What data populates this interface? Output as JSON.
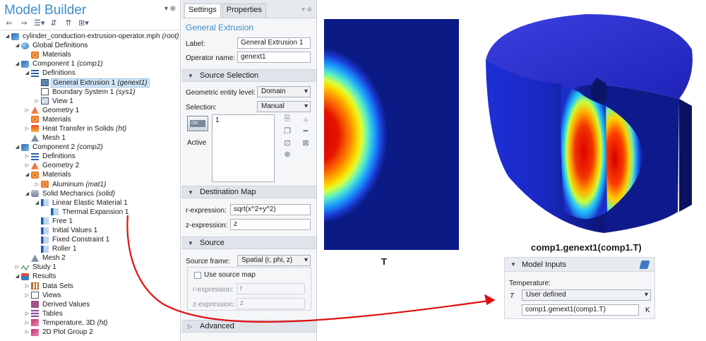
{
  "model_builder": {
    "title": "Model Builder",
    "pin_icons": "▾ ⊕",
    "tree": [
      {
        "depth": 0,
        "tw": "◢",
        "icon": "ic-cube",
        "iconName": "model-root-icon",
        "label": "cylinder_conduction-extrusion-operator.mph",
        "tag": "(root)"
      },
      {
        "depth": 1,
        "tw": "◢",
        "icon": "ic-globe",
        "iconName": "global-definitions-icon",
        "label": "Global Definitions",
        "tag": ""
      },
      {
        "depth": 2,
        "tw": "",
        "icon": "ic-mat",
        "iconName": "materials-icon",
        "label": "Materials",
        "tag": ""
      },
      {
        "depth": 1,
        "tw": "◢",
        "icon": "ic-cube",
        "iconName": "component-icon",
        "label": "Component 1",
        "tag": "(comp1)"
      },
      {
        "depth": 2,
        "tw": "◢",
        "icon": "ic-list",
        "iconName": "definitions-icon",
        "label": "Definitions",
        "tag": ""
      },
      {
        "depth": 3,
        "tw": "",
        "icon": "ic-ext",
        "iconName": "extrusion-icon",
        "label": "General Extrusion 1",
        "tag": "(genext1)",
        "selected": true
      },
      {
        "depth": 3,
        "tw": "",
        "icon": "ic-coord",
        "iconName": "coordinate-system-icon",
        "label": "Boundary System 1",
        "tag": "(sys1)"
      },
      {
        "depth": 3,
        "tw": "▷",
        "icon": "ic-view",
        "iconName": "view-icon",
        "label": "View 1",
        "tag": ""
      },
      {
        "depth": 2,
        "tw": "▷",
        "icon": "ic-geo",
        "iconName": "geometry-icon",
        "label": "Geometry 1",
        "tag": ""
      },
      {
        "depth": 2,
        "tw": "",
        "icon": "ic-mat",
        "iconName": "materials-icon",
        "label": "Materials",
        "tag": ""
      },
      {
        "depth": 2,
        "tw": "▷",
        "icon": "ic-heat",
        "iconName": "heat-transfer-icon",
        "label": "Heat Transfer in Solids",
        "tag": "(ht)"
      },
      {
        "depth": 2,
        "tw": "",
        "icon": "ic-mesh",
        "iconName": "mesh-icon",
        "label": "Mesh 1",
        "tag": ""
      },
      {
        "depth": 1,
        "tw": "◢",
        "icon": "ic-cube",
        "iconName": "component-icon",
        "label": "Component 2",
        "tag": "(comp2)"
      },
      {
        "depth": 2,
        "tw": "▷",
        "icon": "ic-list",
        "iconName": "definitions-icon",
        "label": "Definitions",
        "tag": ""
      },
      {
        "depth": 2,
        "tw": "▷",
        "icon": "ic-geo",
        "iconName": "geometry-icon",
        "label": "Geometry 2",
        "tag": ""
      },
      {
        "depth": 2,
        "tw": "◢",
        "icon": "ic-mat",
        "iconName": "materials-icon",
        "label": "Materials",
        "tag": ""
      },
      {
        "depth": 3,
        "tw": "▷",
        "icon": "ic-mat",
        "iconName": "material-icon",
        "label": "Aluminum",
        "tag": "(mat1)"
      },
      {
        "depth": 2,
        "tw": "◢",
        "icon": "ic-solid",
        "iconName": "solid-mechanics-icon",
        "label": "Solid Mechanics",
        "tag": "(solid)"
      },
      {
        "depth": 3,
        "tw": "◢",
        "icon": "ic-bar",
        "iconName": "linear-elastic-icon",
        "label": "Linear Elastic Material 1",
        "tag": ""
      },
      {
        "depth": 4,
        "tw": "",
        "icon": "ic-bar",
        "iconName": "thermal-expansion-icon",
        "label": "Thermal Expansion 1",
        "tag": ""
      },
      {
        "depth": 3,
        "tw": "",
        "icon": "ic-bar",
        "iconName": "free-icon",
        "label": "Free 1",
        "tag": ""
      },
      {
        "depth": 3,
        "tw": "",
        "icon": "ic-bar",
        "iconName": "initial-values-icon",
        "label": "Initial Values 1",
        "tag": ""
      },
      {
        "depth": 3,
        "tw": "",
        "icon": "ic-bar",
        "iconName": "fixed-constraint-icon",
        "label": "Fixed Constraint 1",
        "tag": ""
      },
      {
        "depth": 3,
        "tw": "",
        "icon": "ic-bar",
        "iconName": "roller-icon",
        "label": "Roller 1",
        "tag": ""
      },
      {
        "depth": 2,
        "tw": "",
        "icon": "ic-mesh",
        "iconName": "mesh-icon",
        "label": "Mesh 2",
        "tag": ""
      },
      {
        "depth": 1,
        "tw": "▷",
        "icon": "ic-study",
        "iconName": "study-icon",
        "label": "Study 1",
        "tag": ""
      },
      {
        "depth": 1,
        "tw": "◢",
        "icon": "ic-res",
        "iconName": "results-icon",
        "label": "Results",
        "tag": ""
      },
      {
        "depth": 2,
        "tw": "▷",
        "icon": "ic-grid",
        "iconName": "data-sets-icon",
        "label": "Data Sets",
        "tag": ""
      },
      {
        "depth": 2,
        "tw": "▷",
        "icon": "ic-coord",
        "iconName": "views-icon",
        "label": "Views",
        "tag": ""
      },
      {
        "depth": 2,
        "tw": "",
        "icon": "ic-val",
        "iconName": "derived-values-icon",
        "label": "Derived Values",
        "tag": ""
      },
      {
        "depth": 2,
        "tw": "▷",
        "icon": "ic-tab",
        "iconName": "tables-icon",
        "label": "Tables",
        "tag": ""
      },
      {
        "depth": 2,
        "tw": "▷",
        "icon": "ic-plot",
        "iconName": "plot-group-icon",
        "label": "Temperature, 3D",
        "tag": "(ht)"
      },
      {
        "depth": 2,
        "tw": "▷",
        "icon": "ic-plot",
        "iconName": "plot-group-icon",
        "label": "2D Plot Group 2",
        "tag": ""
      }
    ]
  },
  "settings": {
    "tabs": [
      "Settings",
      "Properties"
    ],
    "tab_tools": "▾ ⊕",
    "title": "General Extrusion",
    "label_label": "Label:",
    "label_value": "General Extrusion 1",
    "operator_label": "Operator name:",
    "operator_value": "genext1",
    "source_selection_header": "Source Selection",
    "entity_level_label": "Geometric entity level:",
    "entity_level_value": "Domain",
    "selection_label": "Selection:",
    "selection_value": "Manual",
    "selection_item": "1",
    "active_badge": "ON",
    "active_label": "Active",
    "destination_header": "Destination Map",
    "r_label": "r-expression:",
    "r_value": "sqrt(x^2+y^2)",
    "z_label": "z-expression:",
    "z_value": "z",
    "source_header": "Source",
    "frame_label": "Source frame:",
    "frame_value": "Spatial  (r, phi, z)",
    "use_map_label": "Use source map",
    "r2_label": "r-expression:",
    "r2_value": "r",
    "z2_label": "z-expression:",
    "z2_value": "z",
    "advanced_header": "Advanced"
  },
  "plots": {
    "left_caption": "T",
    "right_caption": "comp1.genext1(comp1.T)"
  },
  "model_inputs": {
    "header": "Model Inputs",
    "temperature_label": "Temperature:",
    "symbol": "T",
    "dropdown_value": "User defined",
    "expression_value": "comp1.genext1(comp1.T)",
    "unit": "K"
  },
  "colors": {
    "accent": "#3d8ec9",
    "arrow": "#e01010"
  }
}
